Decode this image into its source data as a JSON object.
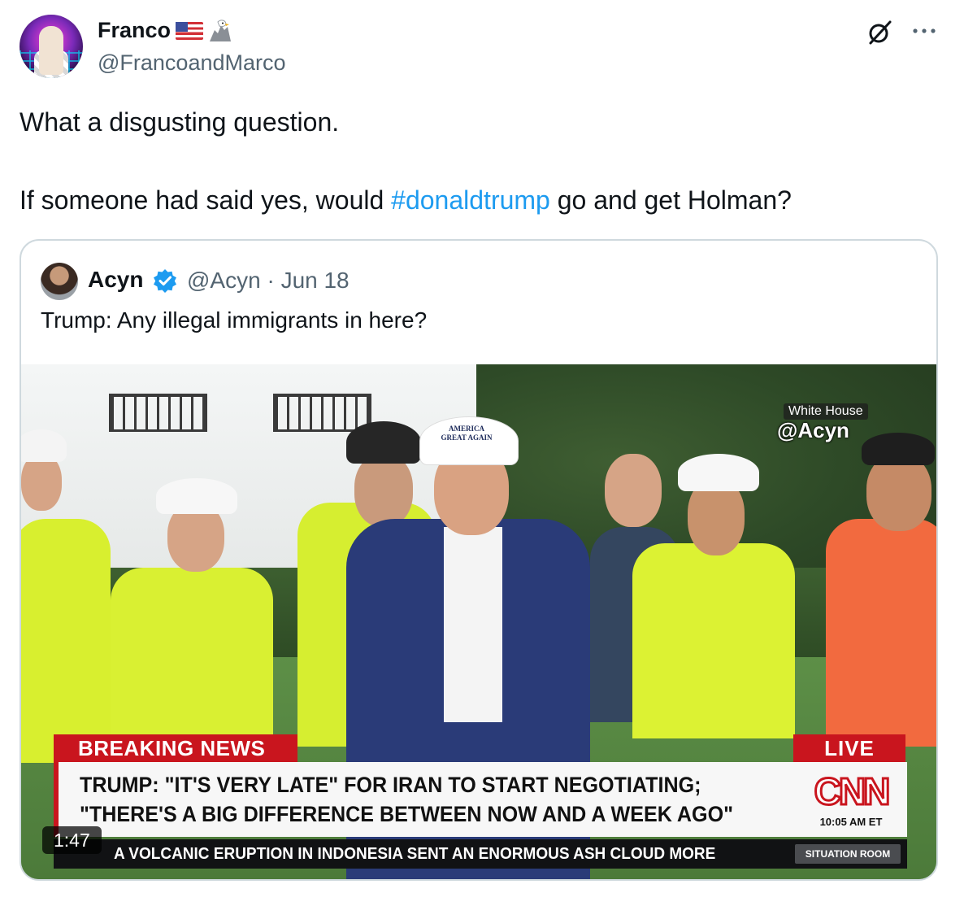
{
  "author": {
    "display_name": "Franco",
    "handle": "@FrancoandMarco",
    "emojis": [
      "us-flag-icon",
      "eagle-icon"
    ]
  },
  "tweet": {
    "line1": "What a disgusting question.",
    "line2_before": "If someone had said yes, would ",
    "hashtag": "#donaldtrump",
    "line2_after": " go and get Holman?"
  },
  "quoted": {
    "display_name": "Acyn",
    "handle": "@Acyn",
    "separator": "·",
    "date": "Jun 18",
    "text": "Trump: Any illegal immigrants in here?",
    "video": {
      "duration": "1:47",
      "watermark_location": "White House",
      "watermark_handle": "@Acyn",
      "breaking_label": "BREAKING NEWS",
      "live_label": "LIVE",
      "headline_line1": "TRUMP: \"IT'S VERY LATE\" FOR IRAN TO START NEGOTIATING;",
      "headline_line2": "\"THERE'S A BIG DIFFERENCE BETWEEN NOW AND A WEEK AGO\"",
      "network": "CNN",
      "time": "10:05 AM ET",
      "ticker": "A VOLCANIC ERUPTION IN INDONESIA SENT AN ENORMOUS ASH CLOUD MORE",
      "ticker_tag": "SITUATION ROOM",
      "hat_text_1": "AMERICA",
      "hat_text_2": "GREAT AGAIN"
    }
  },
  "colors": {
    "text": "#0f1419",
    "muted": "#536471",
    "link": "#1d9bf0",
    "border": "#cfd9de",
    "cnn_red": "#c9151e"
  }
}
